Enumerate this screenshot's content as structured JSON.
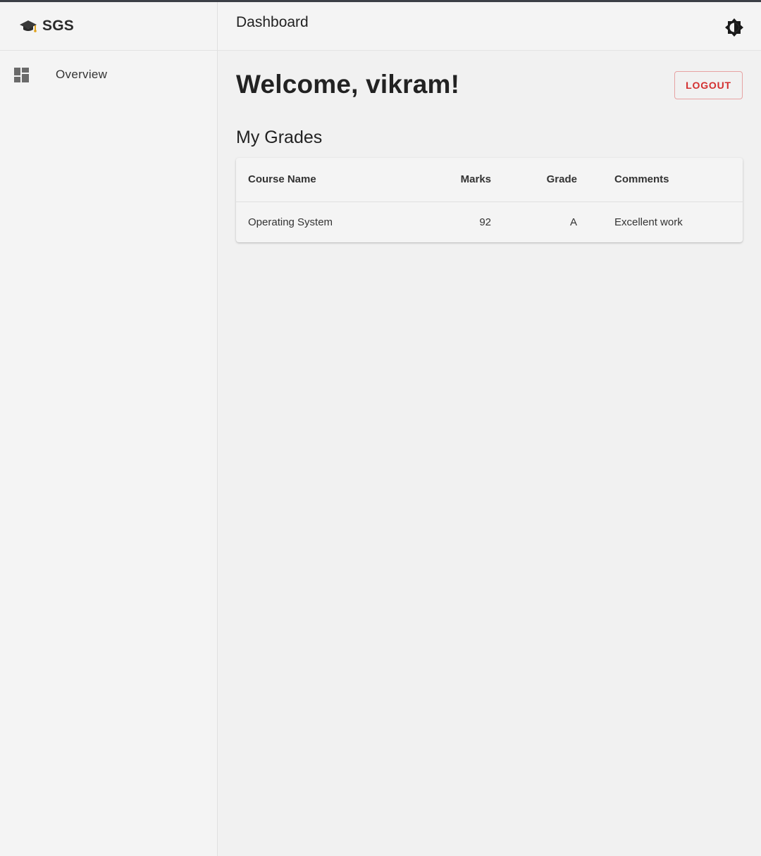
{
  "brand": {
    "name": "SGS"
  },
  "sidebar": {
    "items": [
      {
        "label": "Overview"
      }
    ]
  },
  "topbar": {
    "title": "Dashboard"
  },
  "main": {
    "welcome": "Welcome, vikram!",
    "logout_label": "LOGOUT",
    "section_title": "My Grades",
    "table": {
      "headers": [
        "Course Name",
        "Marks",
        "Grade",
        "Comments"
      ],
      "rows": [
        [
          "Operating System",
          "92",
          "A",
          "Excellent work"
        ]
      ]
    }
  },
  "colors": {
    "accent_red": "#d32f2f",
    "background": "#f1f1f1"
  }
}
